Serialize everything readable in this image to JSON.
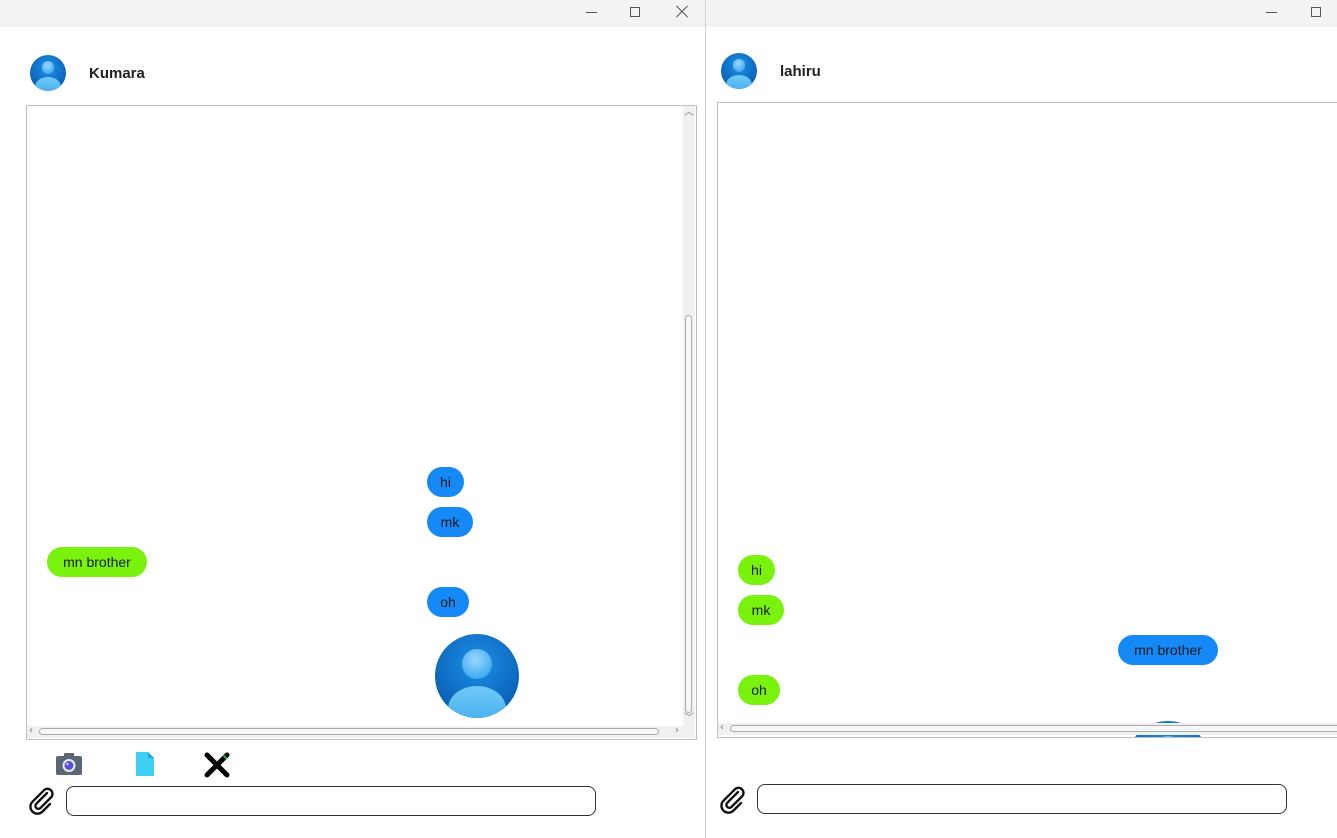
{
  "left_window": {
    "contact_name": "Kumara",
    "input": {
      "value": "",
      "placeholder": ""
    },
    "messages": [
      {
        "text": "hi",
        "side": "sent",
        "color": "#1489f7"
      },
      {
        "text": "mk",
        "side": "sent",
        "color": "#1489f7"
      },
      {
        "text": "mn brother",
        "side": "received",
        "color": "#79f20e"
      },
      {
        "text": "oh",
        "side": "sent",
        "color": "#1489f7"
      }
    ],
    "attachment_toolbar": [
      "camera-icon",
      "file-icon",
      "close-icon"
    ]
  },
  "right_window": {
    "contact_name": "lahiru",
    "input": {
      "value": "",
      "placeholder": ""
    },
    "messages": [
      {
        "text": "hi",
        "side": "received",
        "color": "#79f20e"
      },
      {
        "text": "mk",
        "side": "received",
        "color": "#79f20e"
      },
      {
        "text": "mn brother",
        "side": "sent",
        "color": "#1489f7"
      },
      {
        "text": "oh",
        "side": "received",
        "color": "#79f20e"
      }
    ]
  },
  "colors": {
    "sent_bubble": "#1489f7",
    "received_bubble": "#79f20e",
    "titlebar": "#f3f3f3"
  }
}
